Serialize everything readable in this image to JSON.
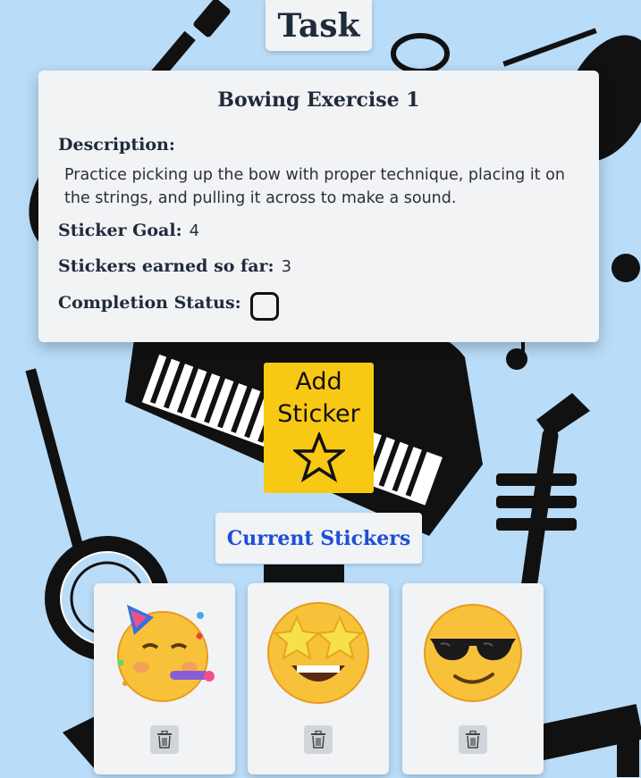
{
  "page": {
    "title": "Task"
  },
  "task": {
    "name": "Bowing Exercise 1",
    "description_label": "Description:",
    "description": "Practice picking up the bow with proper technique, placing it on the strings, and pulling it across to make a sound.",
    "sticker_goal_label": "Sticker Goal:",
    "sticker_goal": "4",
    "stickers_earned_label": "Stickers earned so far:",
    "stickers_earned": "3",
    "completion_status_label": "Completion Status:",
    "completed": false
  },
  "add_sticker": {
    "label": "Add Sticker",
    "icon": "star-icon",
    "color": "#f8c914"
  },
  "current_stickers": {
    "heading": "Current Stickers",
    "heading_color": "#1d4ed8",
    "items": [
      {
        "emoji": "partying-face",
        "delete_icon": "trash-icon"
      },
      {
        "emoji": "star-struck",
        "delete_icon": "trash-icon"
      },
      {
        "emoji": "smiling-face-with-sunglasses",
        "delete_icon": "trash-icon"
      }
    ]
  },
  "colors": {
    "background": "#b9dcf8",
    "card": "#f2f3f5",
    "accent": "#f8c914"
  }
}
